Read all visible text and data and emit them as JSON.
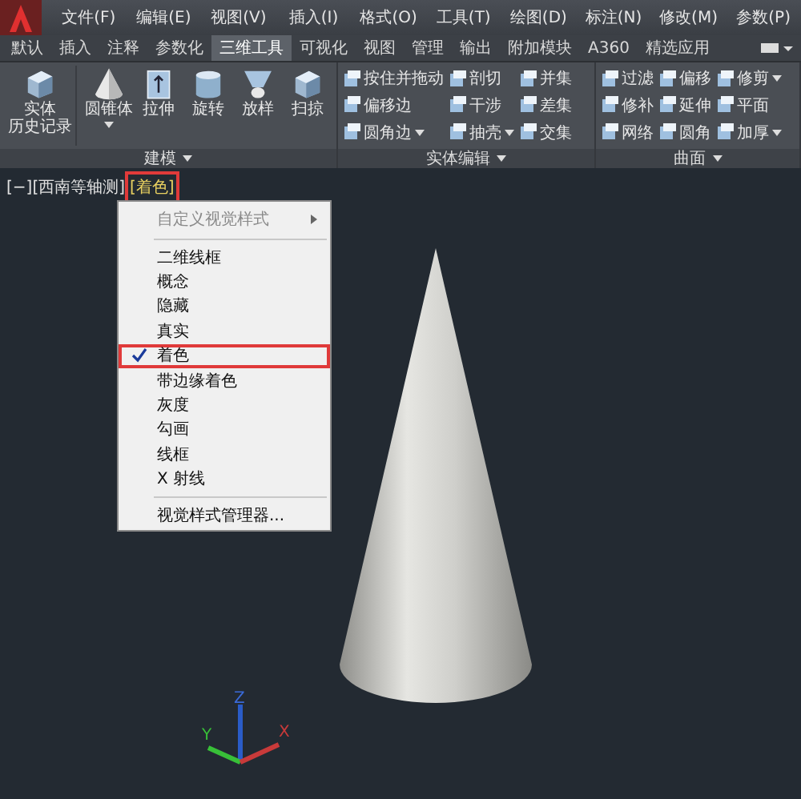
{
  "menu_bar": [
    "文件(F)",
    "编辑(E)",
    "视图(V)",
    "插入(I)",
    "格式(O)",
    "工具(T)",
    "绘图(D)",
    "标注(N)",
    "修改(M)",
    "参数(P)"
  ],
  "ribbon_tabs": [
    {
      "label": "默认",
      "selected": false
    },
    {
      "label": "插入",
      "selected": false
    },
    {
      "label": "注释",
      "selected": false
    },
    {
      "label": "参数化",
      "selected": false
    },
    {
      "label": "三维工具",
      "selected": true
    },
    {
      "label": "可视化",
      "selected": false
    },
    {
      "label": "视图",
      "selected": false
    },
    {
      "label": "管理",
      "selected": false
    },
    {
      "label": "输出",
      "selected": false
    },
    {
      "label": "附加模块",
      "selected": false
    },
    {
      "label": "A360",
      "selected": false
    },
    {
      "label": "精选应用",
      "selected": false
    }
  ],
  "ribbon_panels": [
    {
      "title": "建模",
      "dropdown": true,
      "kind": "large",
      "tools": [
        {
          "label": "实体",
          "label_line_2": "历史记录",
          "dropdown": false
        },
        {
          "label": "圆锥体",
          "dropdown": true
        },
        {
          "label": "拉伸",
          "dropdown": false
        },
        {
          "label": "旋转",
          "dropdown": false
        },
        {
          "label": "放样",
          "dropdown": false
        },
        {
          "label": "扫掠",
          "dropdown": false
        }
      ]
    },
    {
      "title": "实体编辑",
      "dropdown": true,
      "kind": "small",
      "tools": [
        {
          "label": "按住并拖动",
          "dropdown": false
        },
        {
          "label": "偏移边",
          "dropdown": false
        },
        {
          "label": "圆角边",
          "dropdown": true
        },
        {
          "label": "剖切",
          "dropdown": false
        },
        {
          "label": "干涉",
          "dropdown": false
        },
        {
          "label": "抽壳",
          "dropdown": true
        },
        {
          "label": "并集",
          "dropdown": false
        },
        {
          "label": "差集",
          "dropdown": false
        },
        {
          "label": "交集",
          "dropdown": false
        }
      ]
    },
    {
      "title": "曲面",
      "dropdown": true,
      "kind": "small",
      "tools": [
        {
          "label": "过滤",
          "dropdown": false
        },
        {
          "label": "修补",
          "dropdown": false
        },
        {
          "label": "网络",
          "dropdown": false
        },
        {
          "label": "偏移",
          "dropdown": false
        },
        {
          "label": "延伸",
          "dropdown": false
        },
        {
          "label": "圆角",
          "dropdown": false
        },
        {
          "label": "修剪",
          "dropdown": true
        },
        {
          "label": "平面",
          "dropdown": false
        },
        {
          "label": "加厚",
          "dropdown": true
        }
      ]
    }
  ],
  "viewport": {
    "controls": [
      {
        "label": "[−]",
        "highlighted": false
      },
      {
        "label": "[西南等轴测]",
        "highlighted": false
      },
      {
        "label": "[着色]",
        "highlighted": true
      }
    ],
    "axes": [
      {
        "label": "Z"
      },
      {
        "label": "Y"
      },
      {
        "label": "X"
      }
    ]
  },
  "visual_styles_menu": {
    "items": [
      {
        "kind": "item",
        "label": "自定义视觉样式",
        "disabled": true,
        "submenu": true,
        "checked": false,
        "highlighted": false
      },
      {
        "kind": "separator"
      },
      {
        "kind": "item",
        "label": "二维线框",
        "disabled": false,
        "submenu": false,
        "checked": false,
        "highlighted": false
      },
      {
        "kind": "item",
        "label": "概念",
        "disabled": false,
        "submenu": false,
        "checked": false,
        "highlighted": false
      },
      {
        "kind": "item",
        "label": "隐藏",
        "disabled": false,
        "submenu": false,
        "checked": false,
        "highlighted": false
      },
      {
        "kind": "item",
        "label": "真实",
        "disabled": false,
        "submenu": false,
        "checked": false,
        "highlighted": false
      },
      {
        "kind": "item",
        "label": "着色",
        "disabled": false,
        "submenu": false,
        "checked": true,
        "highlighted": true
      },
      {
        "kind": "item",
        "label": "带边缘着色",
        "disabled": false,
        "submenu": false,
        "checked": false,
        "highlighted": false
      },
      {
        "kind": "item",
        "label": "灰度",
        "disabled": false,
        "submenu": false,
        "checked": false,
        "highlighted": false
      },
      {
        "kind": "item",
        "label": "勾画",
        "disabled": false,
        "submenu": false,
        "checked": false,
        "highlighted": false
      },
      {
        "kind": "item",
        "label": "线框",
        "disabled": false,
        "submenu": false,
        "checked": false,
        "highlighted": false
      },
      {
        "kind": "item",
        "label": "X 射线",
        "disabled": false,
        "submenu": false,
        "checked": false,
        "highlighted": false
      },
      {
        "kind": "separator"
      },
      {
        "kind": "item",
        "label": "视觉样式管理器...",
        "disabled": false,
        "submenu": false,
        "checked": false,
        "highlighted": false
      }
    ]
  }
}
